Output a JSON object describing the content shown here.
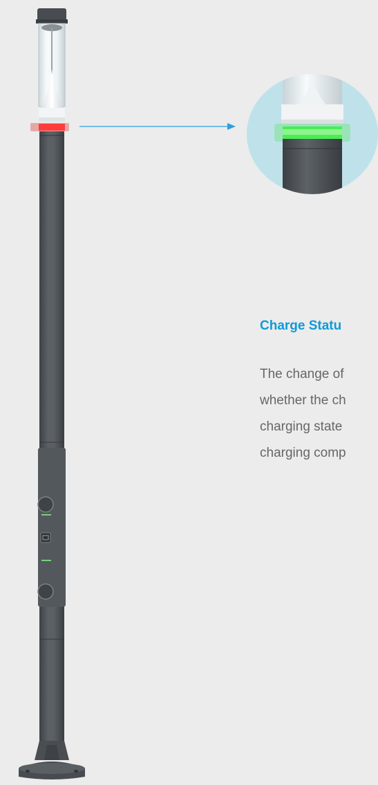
{
  "colors": {
    "background": "#ececec",
    "accent": "#0f9ad8",
    "body_text": "#666666",
    "pole": "#505458",
    "indicator_red": "#ff3b3b",
    "indicator_green": "#45e34a",
    "detail_bg": "#bfe2ea"
  },
  "icons": {
    "pole": "street-light-charging-pole",
    "indicator": "led-ring-indicator",
    "arrow": "arrow-right"
  },
  "section": {
    "title": "Charge Statu",
    "lines": [
      "The change of",
      "whether the ch",
      "charging state",
      "charging comp"
    ]
  }
}
